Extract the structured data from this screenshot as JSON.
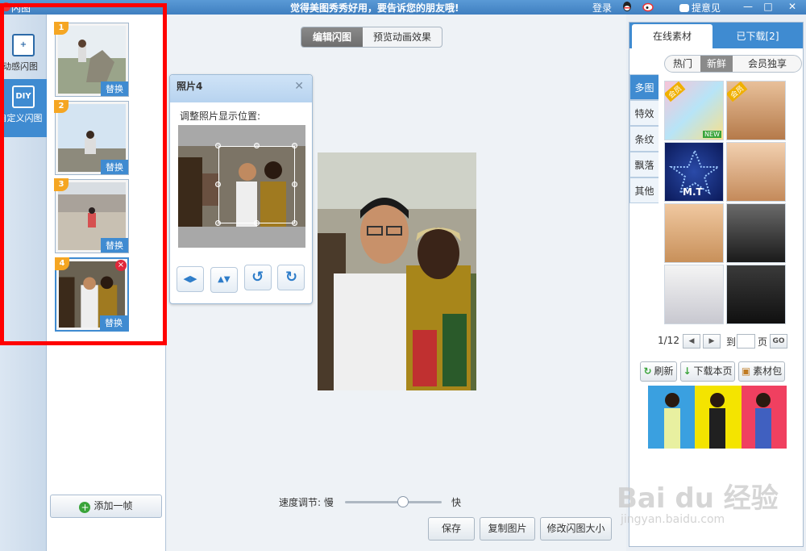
{
  "titlebar": {
    "app_title": "闪图",
    "slogan": "觉得美图秀秀好用，要告诉您的朋友哦!",
    "login": "登录",
    "feedback": "提意见",
    "minimize": "—",
    "maximize": "□",
    "close": "✕"
  },
  "tools": [
    {
      "icon": "+",
      "label": "动感闪图"
    },
    {
      "icon": "DIY",
      "label": "自定义闪图"
    }
  ],
  "frames": [
    {
      "num": "1",
      "replace": "替换"
    },
    {
      "num": "2",
      "replace": "替换"
    },
    {
      "num": "3",
      "replace": "替换"
    },
    {
      "num": "4",
      "replace": "替换",
      "delete": "×"
    }
  ],
  "add_frame": "添加一帧",
  "mode_tabs": {
    "edit": "编辑闪图",
    "preview": "预览动画效果"
  },
  "photo_panel": {
    "title": "照片4",
    "close": "✕",
    "hint": "调整照片显示位置:",
    "buttons": [
      "◀▶",
      "▲▼",
      "↺",
      "↻"
    ]
  },
  "speed": {
    "label": "速度调节: 慢",
    "fast": "快",
    "level": 0.6
  },
  "actions": {
    "save": "保存",
    "copy": "复制图片",
    "resize": "修改闪图大小"
  },
  "materials": {
    "tab_online": "在线素材",
    "tab_downloaded": "已下载[2]",
    "sub_tabs": [
      "热门",
      "新鲜",
      "会员独享"
    ],
    "categories": [
      "多图",
      "特效",
      "条纹",
      "飘落",
      "其他"
    ],
    "badges": {
      "member": "会员",
      "new": "NEW",
      "mt": "M.T"
    },
    "pager": {
      "page": "1/12",
      "goto": "到",
      "unit": "页",
      "go": "GO"
    },
    "refresh": "刷新",
    "download_page": "下载本页",
    "pack": "素材包"
  },
  "watermark": {
    "main": "Bai du 经验",
    "sub": "jingyan.baidu.com"
  }
}
